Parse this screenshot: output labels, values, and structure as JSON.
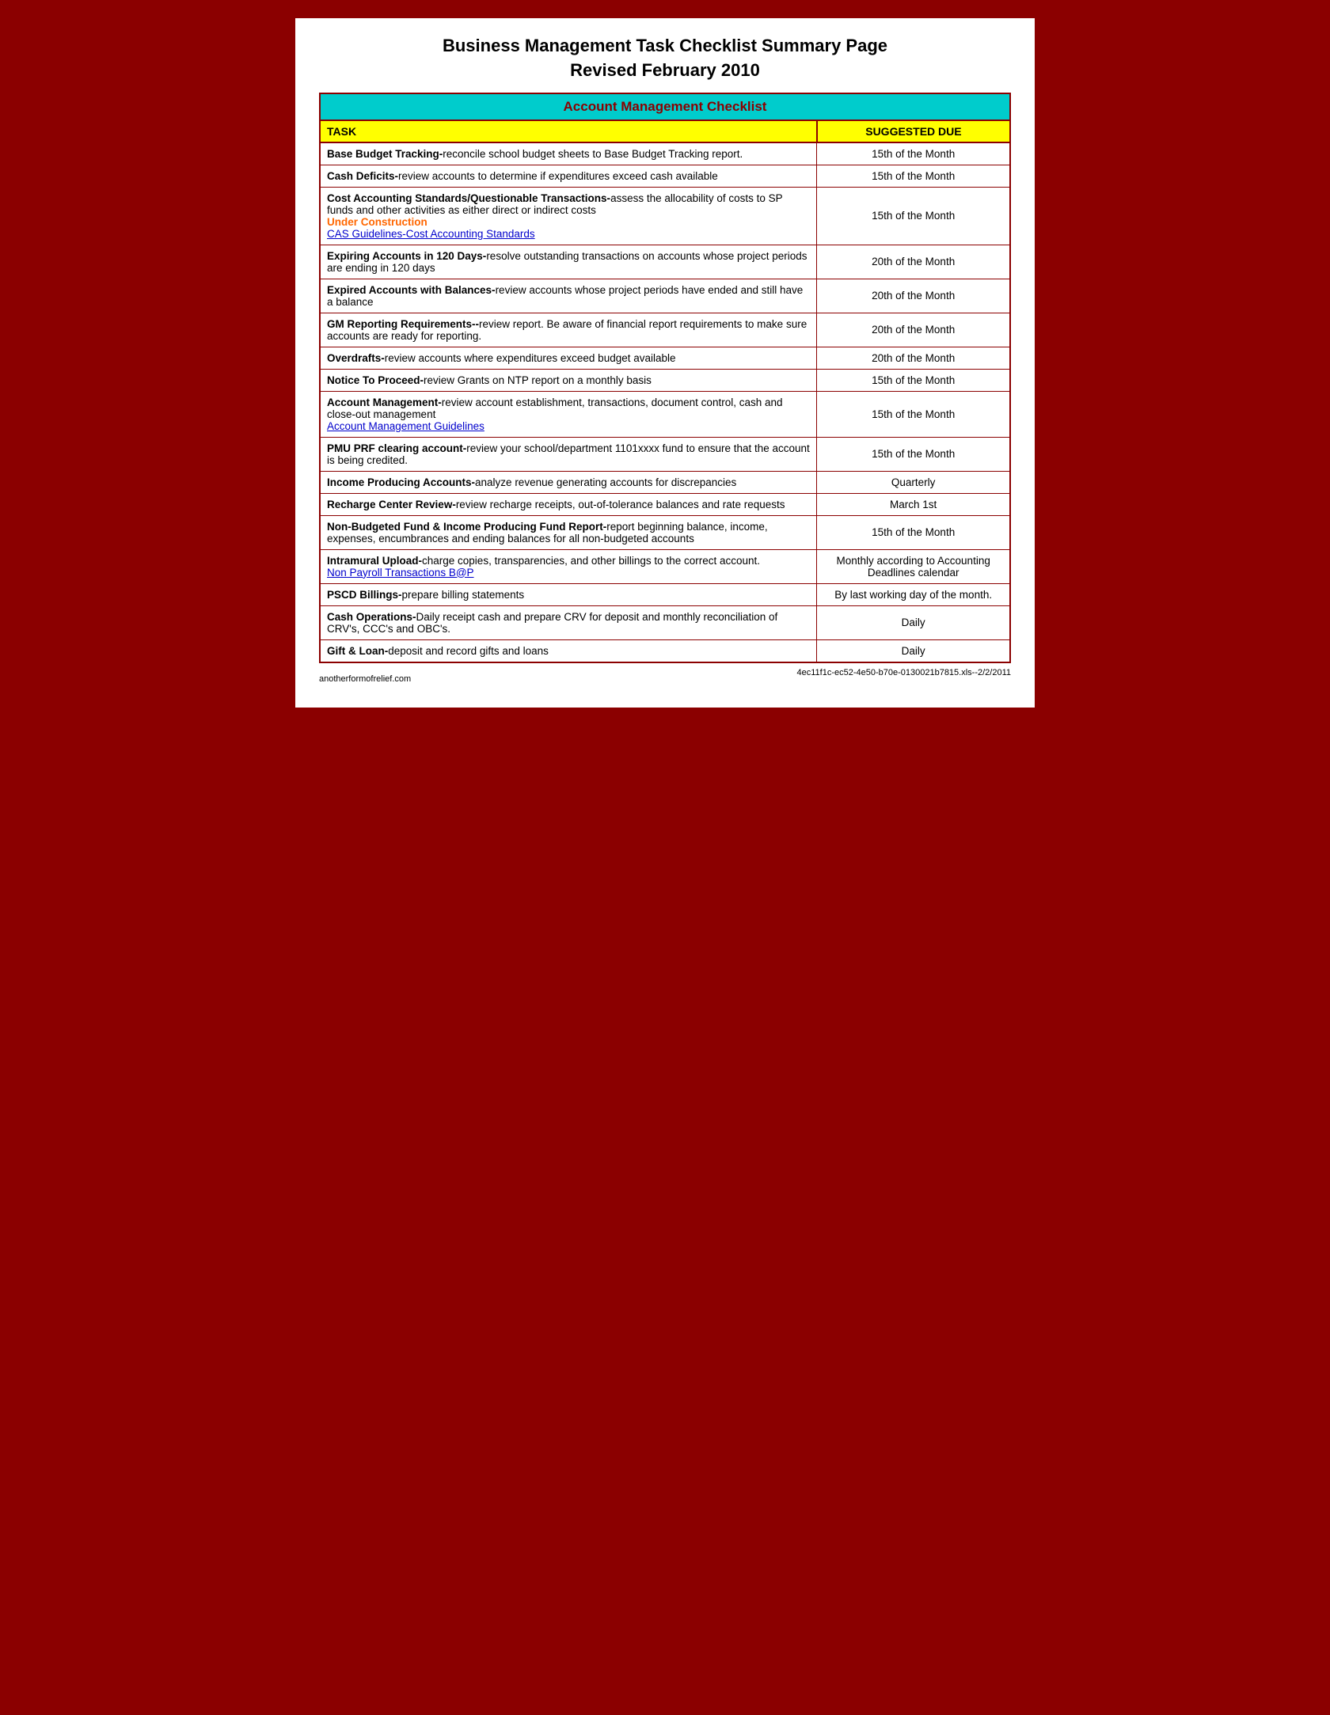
{
  "title": {
    "line1": "Business Management Task Checklist Summary Page",
    "line2": "Revised February 2010"
  },
  "table": {
    "header_title": "Account Management Checklist",
    "col_task": "TASK",
    "col_due": "SUGGESTED DUE",
    "rows": [
      {
        "task_bold": "Base Budget Tracking-",
        "task_text": "reconcile school budget sheets to Base Budget Tracking report.",
        "due": "15th of the Month",
        "link": null,
        "under_construction": null
      },
      {
        "task_bold": "Cash Deficits-",
        "task_text": "review accounts to determine if expenditures exceed cash available",
        "due": "15th of the Month",
        "link": null,
        "under_construction": null
      },
      {
        "task_bold": "Cost Accounting Standards/Questionable Transactions-",
        "task_text": "assess the allocability of costs to SP funds and other activities as either direct or indirect costs",
        "due": "15th of the Month",
        "link": "CAS Guidelines-Cost Accounting Standards",
        "under_construction": "Under Construction"
      },
      {
        "task_bold": "Expiring Accounts in 120 Days-",
        "task_text": "resolve outstanding transactions on accounts whose project periods are ending in 120 days",
        "due": "20th of the Month",
        "link": null,
        "under_construction": null
      },
      {
        "task_bold": "Expired Accounts with Balances-",
        "task_text": "review accounts whose project periods have ended and still have a balance",
        "due": "20th of the Month",
        "link": null,
        "under_construction": null
      },
      {
        "task_bold": "GM Reporting Requirements--",
        "task_text": "review report.  Be aware of financial report requirements to make sure accounts are ready for reporting.",
        "due": "20th of the Month",
        "link": null,
        "under_construction": null
      },
      {
        "task_bold": "Overdrafts-",
        "task_text": "review accounts where expenditures exceed budget available",
        "due": "20th of the Month",
        "link": null,
        "under_construction": null
      },
      {
        "task_bold": "Notice To Proceed-",
        "task_text": "review Grants on NTP report on a monthly basis",
        "due": "15th of the Month",
        "link": null,
        "under_construction": null
      },
      {
        "task_bold": "Account Management-",
        "task_text": "review account establishment, transactions, document control, cash and close-out management",
        "due": "15th of the Month",
        "link": "Account Management Guidelines",
        "under_construction": null
      },
      {
        "task_bold": "PMU PRF clearing account-",
        "task_text": "review your school/department 1101xxxx fund to ensure that the account is being credited.",
        "due": "15th of the Month",
        "link": null,
        "under_construction": null
      },
      {
        "task_bold": "Income Producing Accounts-",
        "task_text": "analyze revenue generating accounts for discrepancies",
        "due": "Quarterly",
        "link": null,
        "under_construction": null
      },
      {
        "task_bold": "Recharge Center Review-",
        "task_text": "review recharge receipts, out-of-tolerance balances and rate requests",
        "due": "March 1st",
        "link": null,
        "under_construction": null
      },
      {
        "task_bold": "Non-Budgeted Fund & Income Producing Fund Report-",
        "task_text": "report beginning balance, income, expenses, encumbrances and ending balances for all non-budgeted accounts",
        "due": "15th of the Month",
        "link": null,
        "under_construction": null
      },
      {
        "task_bold": "Intramural Upload-",
        "task_text": "charge copies, transparencies, and other billings to the correct account.",
        "due": "Monthly according to Accounting Deadlines calendar",
        "link": "Non Payroll Transactions B@P",
        "under_construction": null
      },
      {
        "task_bold": "PSCD Billings-",
        "task_text": "prepare billing statements",
        "due": "By last working day of the month.",
        "link": null,
        "under_construction": null
      },
      {
        "task_bold": "Cash Operations-",
        "task_text": "Daily receipt cash and prepare CRV for deposit and monthly reconciliation of CRV's, CCC's  and OBC's.",
        "due": "Daily",
        "link": null,
        "under_construction": null
      },
      {
        "task_bold": "Gift & Loan-",
        "task_text": "deposit and record gifts and loans",
        "due": "Daily",
        "link": null,
        "under_construction": null
      }
    ]
  },
  "footer": {
    "left": "anotherformofrelief.com",
    "right": "4ec11f1c-ec52-4e50-b70e-0130021b7815.xls--2/2/2011"
  }
}
